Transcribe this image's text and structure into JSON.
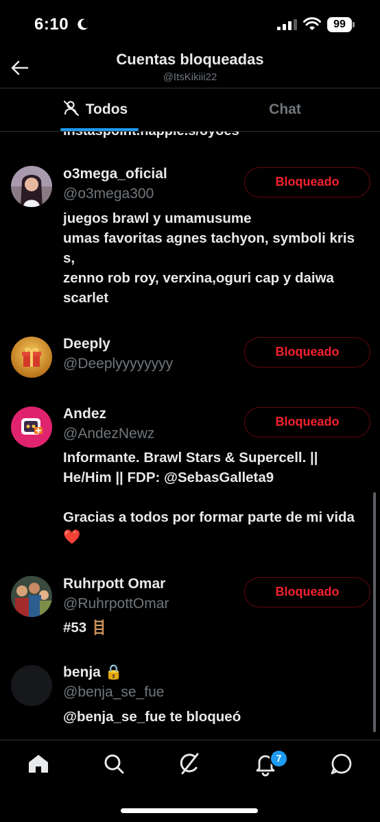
{
  "status_bar": {
    "time": "6:10",
    "battery": "99"
  },
  "header": {
    "title": "Cuentas bloqueadas",
    "subtitle": "@ItsKikiii22"
  },
  "tabs": [
    {
      "label": "Todos"
    },
    {
      "label": "Chat"
    }
  ],
  "clipped_text": "instaspoint.happie.s/oyoes",
  "accounts": [
    {
      "name": "o3mega_oficial",
      "handle": "@o3mega300",
      "button": "Bloqueado",
      "bio": "juegos brawl y umamusume\numas favoritas agnes tachyon, symboli kris s,\nzenno rob roy, verxina,oguri cap y daiwa scarlet"
    },
    {
      "name": "Deeply",
      "handle": "@Deeplyyyyyyyy",
      "button": "Bloqueado",
      "bio": ""
    },
    {
      "name": "Andez",
      "handle": "@AndezNewz",
      "button": "Bloqueado",
      "bio": "Informante. Brawl Stars & Supercell. || He/Him || FDP: @SebasGalleta9\n\nGracias a todos por formar parte de mi vida ❤️"
    },
    {
      "name": "Ruhrpott Omar",
      "handle": "@RuhrpottOmar",
      "button": "Bloqueado",
      "bio": "#53 🪜"
    },
    {
      "name": "benja 🔒",
      "handle": "@benja_se_fue",
      "button": "",
      "bio": "@benja_se_fue te bloqueó"
    }
  ],
  "nav": {
    "items": [
      "home-icon",
      "search-icon",
      "grok-icon",
      "notifications-icon",
      "messages-icon"
    ],
    "notifications_badge": "7"
  },
  "colors": {
    "accent": "#1d9bf0",
    "blocked_red": "#f4212e",
    "secondary_text": "#71767b"
  }
}
